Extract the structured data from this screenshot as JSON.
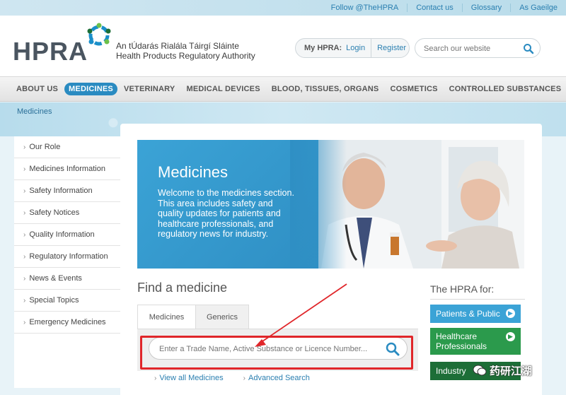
{
  "topbar": {
    "links": [
      "Follow @TheHPRA",
      "Contact us",
      "Glossary",
      "As Gaeilge"
    ]
  },
  "header": {
    "logo_word": "HPRA",
    "logo_line1": "An tÚdarás Rialála Táirgí Sláinte",
    "logo_line2": "Health Products Regulatory Authority",
    "myhpra_label": "My HPRA:",
    "login_label": "Login",
    "register_label": "Register",
    "search_placeholder": "Search our website"
  },
  "nav": {
    "items": [
      "ABOUT US",
      "MEDICINES",
      "VETERINARY",
      "MEDICAL DEVICES",
      "BLOOD, TISSUES, ORGANS",
      "COSMETICS",
      "CONTROLLED SUBSTANCES"
    ],
    "active_index": 1
  },
  "breadcrumb": "Medicines",
  "sidebar": {
    "items": [
      "Our Role",
      "Medicines Information",
      "Safety Information",
      "Safety Notices",
      "Quality Information",
      "Regulatory Information",
      "News & Events",
      "Special Topics",
      "Emergency Medicines"
    ]
  },
  "hero": {
    "title": "Medicines",
    "text": "Welcome to the medicines section. This area includes safety and quality updates for patients and healthcare professionals, and regulatory news for industry."
  },
  "find": {
    "title": "Find a medicine",
    "tabs": [
      "Medicines",
      "Generics"
    ],
    "placeholder": "Enter a Trade Name, Active Substance or Licence Number...",
    "links": [
      "View all Medicines",
      "Advanced Search"
    ]
  },
  "hpra_for": {
    "title": "The HPRA for:",
    "buttons": [
      "Patients & Public",
      "Healthcare Professionals",
      "Industry"
    ]
  },
  "watermark": "药研江湖",
  "colors": {
    "accent": "#2a8bc1",
    "hero_blue": "#3ba3d6",
    "green": "#2b9a4c",
    "dark_green": "#1d6e37",
    "annotation_red": "#e0262a"
  }
}
